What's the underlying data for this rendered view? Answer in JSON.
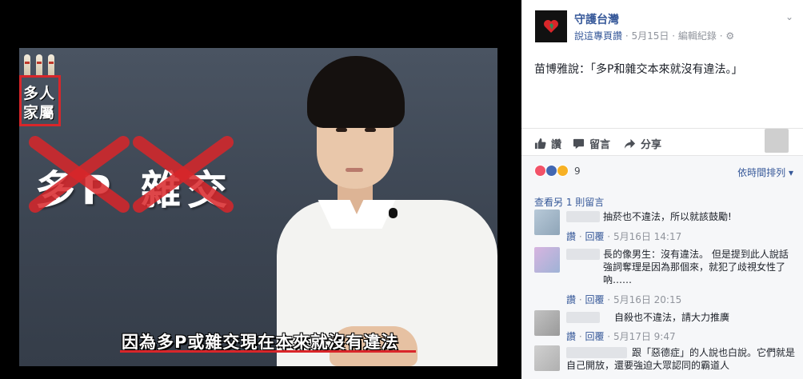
{
  "photo": {
    "logo_line1": "多人",
    "logo_line2": "家屬",
    "strike_word1": "多P",
    "strike_word2": "雜交",
    "caption": "因為多P或雜交現在本來就沒有違法"
  },
  "post": {
    "page_name": "守護台灣",
    "meta_like": "說這專頁讚",
    "meta_sep": "·",
    "meta_date": "5月15日",
    "meta_edit": "編輯紀錄",
    "text": "苗博雅說：「多P和雜交本來就沒有違法。」"
  },
  "actions": {
    "like": "讚",
    "comment": "留言",
    "share": "分享"
  },
  "reactions": {
    "count": "9",
    "sort_label": "依時間排列"
  },
  "comments": {
    "more_label": "查看另 1 則留言",
    "items": [
      {
        "text": "抽菸也不違法，所以就該鼓勵!",
        "like": "讚",
        "reply": "回覆",
        "time": "5月16日 14:17"
      },
      {
        "text": "長的像男生：沒有違法。 但是提到此人說話 強詞奪理是因為那個來，就犯了歧視女性了吶……",
        "like": "讚",
        "reply": "回覆",
        "time": "5月16日 20:15"
      },
      {
        "text": "自殺也不違法，請大力推廣",
        "like": "讚",
        "reply": "回覆",
        "time": "5月17日 9:47"
      },
      {
        "text": "跟「惡德症」的人說也白說。它們就是自己開放，還要強迫大眾認同的霸道人"
      }
    ]
  },
  "colors": {
    "link_blue": "#365899",
    "caption_red": "#d9262a",
    "panel_bg": "#ffffff",
    "comments_bg": "#f6f7f9"
  }
}
